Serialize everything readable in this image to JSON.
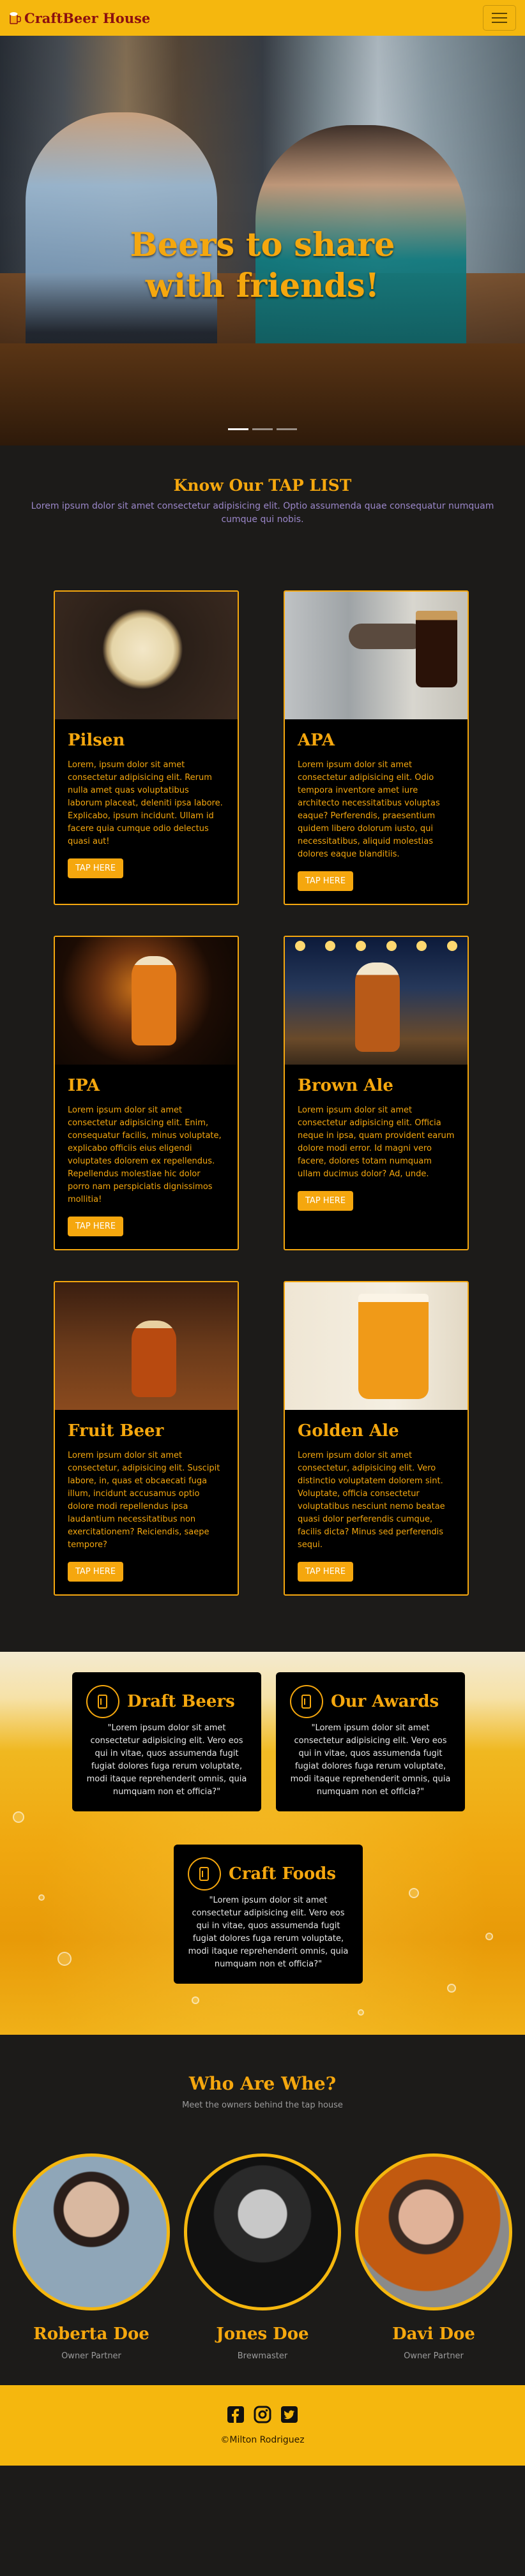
{
  "navbar": {
    "brand": "CraftBeer House",
    "logo_icon": "beer-mug-icon",
    "toggle_icon": "hamburger-icon"
  },
  "hero": {
    "title_line1": "Beers to share",
    "title_line2": "with friends!",
    "slides": 3,
    "active_slide": 1
  },
  "taplist": {
    "title": "Know Our TAP LIST",
    "description": "Lorem ipsum dolor sit amet consectetur adipisicing elit. Optio assumenda quae consequatur numquam cumque qui nobis."
  },
  "cards": [
    {
      "name": "Pilsen",
      "text": "Lorem, ipsum dolor sit amet consectetur adipisicing elit. Rerum nulla amet quas voluptatibus laborum placeat, deleniti ipsa labore. Explicabo, ipsum incidunt. Ullam id facere quia cumque odio delectus quasi aut!",
      "button": "TAP HERE"
    },
    {
      "name": "APA",
      "text": "Lorem ipsum dolor sit amet consectetur adipisicing elit. Odio tempora inventore amet iure architecto necessitatibus voluptas eaque? Perferendis, praesentium quidem libero dolorum iusto, qui necessitatibus, aliquid molestias dolores eaque blanditiis.",
      "button": "TAP HERE"
    },
    {
      "name": "IPA",
      "text": "Lorem ipsum dolor sit amet consectetur adipisicing elit. Enim, consequatur facilis, minus voluptate, explicabo officiis eius eligendi voluptates dolorem ex repellendus. Repellendus molestiae hic dolor porro nam perspiciatis dignissimos mollitia!",
      "button": "TAP HERE"
    },
    {
      "name": "Brown Ale",
      "text": "Lorem ipsum dolor sit amet consectetur adipisicing elit. Officia neque in ipsa, quam provident earum dolore modi error. Id magni vero facere, dolores totam numquam ullam ducimus dolor? Ad, unde.",
      "button": "TAP HERE"
    },
    {
      "name": "Fruit Beer",
      "text": "Lorem ipsum dolor sit amet consectetur, adipisicing elit. Suscipit labore, in, quas et obcaecati fuga illum, incidunt accusamus optio dolore modi repellendus ipsa laudantium necessitatibus non exercitationem? Reiciendis, saepe tempore?",
      "button": "TAP HERE"
    },
    {
      "name": "Golden Ale",
      "text": "Lorem ipsum dolor sit amet consectetur, adipisicing elit. Vero distinctio voluptatem dolorem sint. Voluptate, officia consectetur voluptatibus nesciunt nemo beatae quasi dolor perferendis cumque, facilis dicta? Minus sed perferendis sequi.",
      "button": "TAP HERE"
    }
  ],
  "features": [
    {
      "title": "Draft Beers",
      "icon": "beer-glass-icon",
      "text": "\"Lorem ipsum dolor sit amet consectetur adipisicing elit. Vero eos qui in vitae, quos assumenda fugit fugiat dolores fuga rerum voluptate, modi itaque reprehenderit omnis, quia numquam non et officia?\""
    },
    {
      "title": "Our Awards",
      "icon": "beer-glass-icon",
      "text": "\"Lorem ipsum dolor sit amet consectetur adipisicing elit. Vero eos qui in vitae, quos assumenda fugit fugiat dolores fuga rerum voluptate, modi itaque reprehenderit omnis, quia numquam non et officia?\""
    },
    {
      "title": "Craft Foods",
      "icon": "beer-glass-icon",
      "text": "\"Lorem ipsum dolor sit amet consectetur adipisicing elit. Vero eos qui in vitae, quos assumenda fugit fugiat dolores fuga rerum voluptate, modi itaque reprehenderit omnis, quia numquam non et officia?\""
    }
  ],
  "team": {
    "title": "Who Are Whe?",
    "subtitle": "Meet the owners behind the tap house",
    "members": [
      {
        "name": "Roberta Doe",
        "role": "Owner Partner"
      },
      {
        "name": "Jones Doe",
        "role": "Brewmaster"
      },
      {
        "name": "Davi Doe",
        "role": "Owner Partner"
      }
    ]
  },
  "footer": {
    "social_icons": [
      "facebook-icon",
      "instagram-icon",
      "twitter-icon"
    ],
    "copyright": "©Milton Rodriguez"
  },
  "colors": {
    "accent": "#f5a70e",
    "navbar": "#f5b70e",
    "background": "#1c1b19",
    "card_bg": "#000000",
    "brand_text": "#8b1010"
  }
}
